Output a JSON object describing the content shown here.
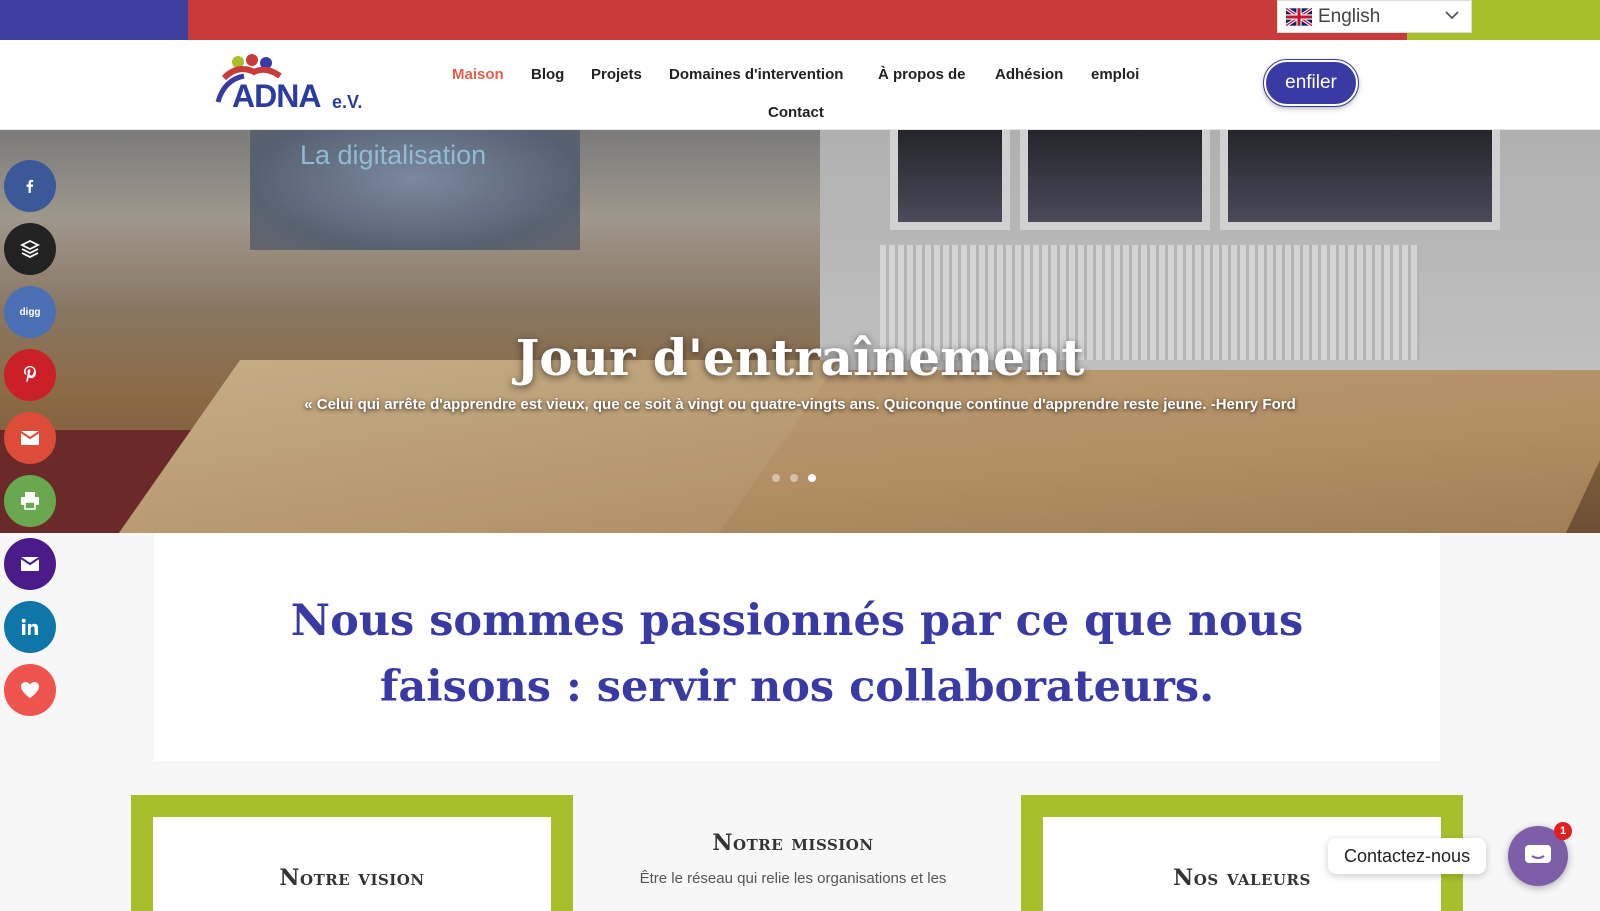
{
  "topbar": {
    "colors": {
      "blue": "#3f3fa0",
      "red": "#c93a3a",
      "green": "#a8bf2c"
    },
    "social": [
      "facebook-icon",
      "twitter-icon",
      "youtube-icon"
    ],
    "language": {
      "selected": "English",
      "flag": "uk-flag-icon"
    }
  },
  "header": {
    "logo_text": "ADNA",
    "logo_suffix": "e.V.",
    "nav": [
      {
        "label": "Maison",
        "active": true
      },
      {
        "label": "Blog"
      },
      {
        "label": "Projets"
      },
      {
        "label": "Domaines d'intervention"
      },
      {
        "label": "À propos de"
      },
      {
        "label": "Adhésion"
      },
      {
        "label": "emploi"
      },
      {
        "label": "Contact"
      }
    ],
    "cta_label": "enfiler",
    "accent": "#e0604a"
  },
  "hero": {
    "projection_text": "La digitalisation",
    "title": "Jour d'entraînement",
    "subtitle": "« Celui qui arrête d'apprendre est vieux, que ce soit à vingt ou quatre-vingts ans. Quiconque continue d'apprendre reste jeune. -Henry Ford",
    "slides": 3,
    "active_slide": 3
  },
  "share_bar": [
    {
      "name": "facebook",
      "icon": "facebook-icon",
      "color": "#3b5998"
    },
    {
      "name": "buffer",
      "icon": "buffer-icon",
      "color": "#222222"
    },
    {
      "name": "digg",
      "icon": "digg-icon",
      "color": "#4a6fb5",
      "label": "digg"
    },
    {
      "name": "pinterest",
      "icon": "pinterest-icon",
      "color": "#cb2027"
    },
    {
      "name": "gmail",
      "icon": "mail-icon",
      "color": "#dd4b39"
    },
    {
      "name": "print",
      "icon": "print-icon",
      "color": "#6aa84f"
    },
    {
      "name": "email",
      "icon": "envelope-icon",
      "color": "#4b1b8a"
    },
    {
      "name": "linkedin",
      "icon": "linkedin-icon",
      "color": "#0e76a8"
    },
    {
      "name": "favorite",
      "icon": "heart-icon",
      "color": "#f0544f"
    }
  ],
  "mission_statement": {
    "line1": "Nous sommes passionnés par ce que nous",
    "line2": "faisons : servir nos collaborateurs."
  },
  "cards": {
    "vision": "Notre vision",
    "mission": "Notre mission",
    "mission_text": "Être le réseau qui relie les organisations et les",
    "values": "Nos valeurs"
  },
  "chat": {
    "label": "Contactez-nous",
    "badge": "1"
  }
}
